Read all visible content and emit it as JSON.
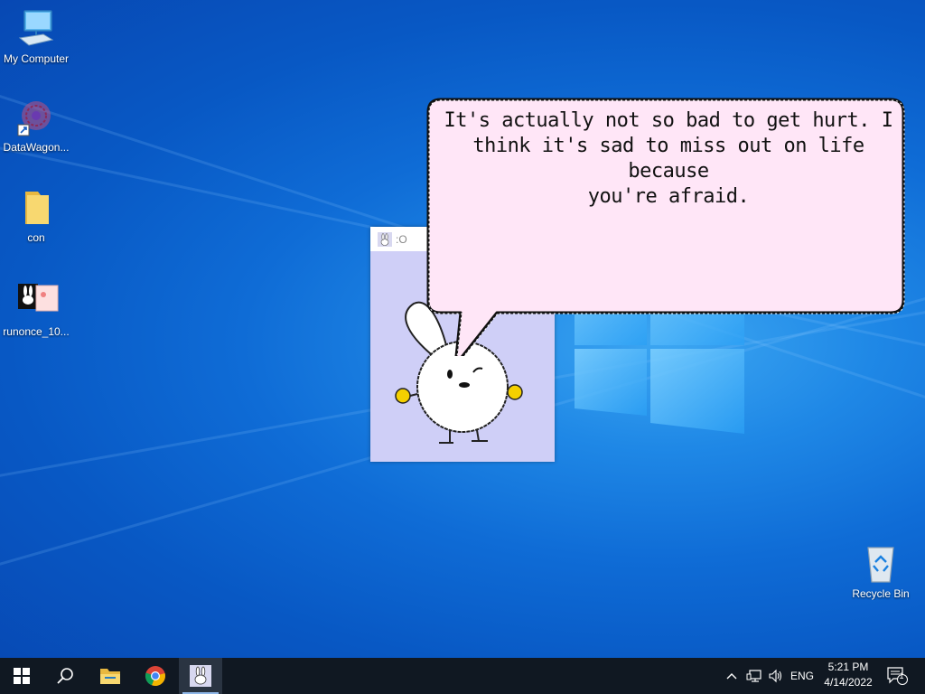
{
  "desktop": {
    "icons": [
      {
        "label": "My Computer",
        "icon": "computer-icon"
      },
      {
        "label": "DataWagon...",
        "icon": "datawagon-icon"
      },
      {
        "label": "con",
        "icon": "folder-icon"
      },
      {
        "label": "runonce_10...",
        "icon": "runonce-icon"
      },
      {
        "label": "Recycle Bin",
        "icon": "recycle-bin-icon"
      }
    ]
  },
  "pet_window": {
    "title": ":O",
    "icon": "bunny-icon"
  },
  "bubble": {
    "lines": [
      "It's actually not so bad to get hurt. I",
      "think it's sad to miss out on life because",
      "you're afraid."
    ]
  },
  "taskbar": {
    "buttons": [
      {
        "name": "start",
        "icon": "windows-start-icon"
      },
      {
        "name": "search",
        "icon": "search-icon"
      },
      {
        "name": "file-explorer",
        "icon": "folder-icon"
      },
      {
        "name": "chrome",
        "icon": "chrome-icon"
      },
      {
        "name": "bunny-app",
        "icon": "bunny-icon"
      }
    ],
    "tray": {
      "language": "ENG",
      "time": "5:21 PM",
      "date": "4/14/2022",
      "notification_count": "1"
    }
  },
  "colors": {
    "taskbar_bg": "#101822",
    "bubble_fill": "#ffe6f7",
    "pet_bg": "#cfcff7",
    "accent": "#8fb7e8"
  }
}
